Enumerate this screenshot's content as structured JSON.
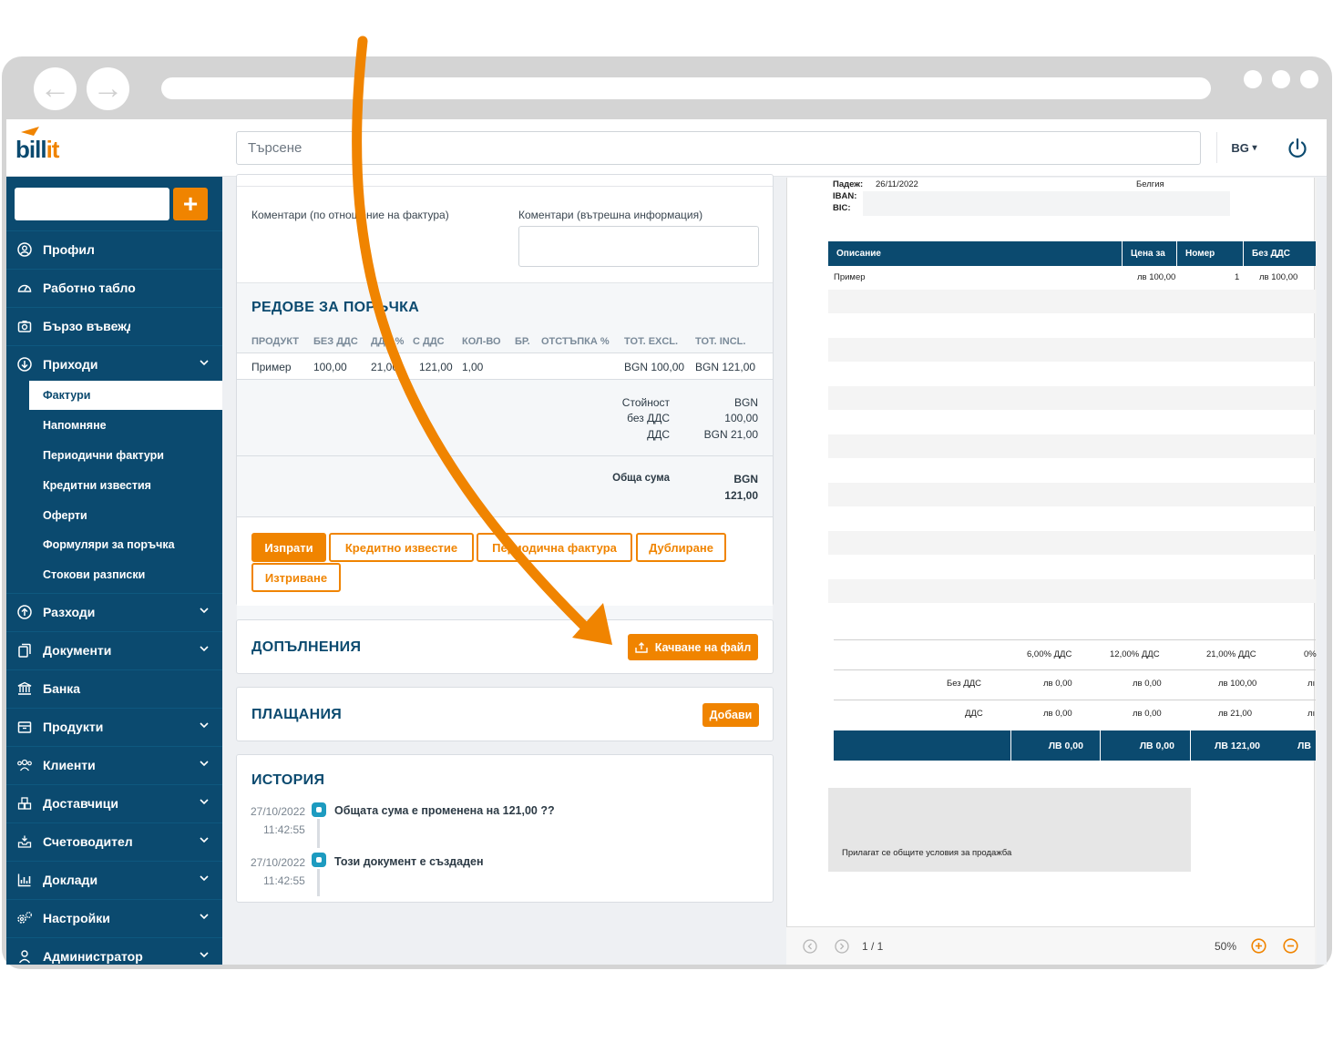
{
  "browser": {
    "back_glyph": "←",
    "forward_glyph": "→"
  },
  "topbar": {
    "logo_left": "bill",
    "logo_right": "it",
    "search_placeholder": "Търсене",
    "language": "BG",
    "language_caret": "▾"
  },
  "sidebar": {
    "plus": "+",
    "items": [
      {
        "label": "Профил",
        "icon": "user-circle-icon"
      },
      {
        "label": "Работно табло",
        "icon": "dashboard-icon"
      },
      {
        "label": "Бързо въвеждане",
        "icon": "camera-icon"
      },
      {
        "label": "Приходи",
        "icon": "income-arrow-icon"
      }
    ],
    "subitems": [
      "Фактури",
      "Напомняне",
      "Периодични фактури",
      "Кредитни известия",
      "Оферти",
      "Формуляри за поръчка",
      "Стокови разписки"
    ],
    "items2": [
      {
        "label": "Разходи",
        "icon": "expense-arrow-icon"
      },
      {
        "label": "Документи",
        "icon": "documents-icon"
      },
      {
        "label": "Банка",
        "icon": "bank-icon"
      },
      {
        "label": "Продукти",
        "icon": "box-icon"
      },
      {
        "label": "Клиенти",
        "icon": "users-icon"
      },
      {
        "label": "Доставчици",
        "icon": "boxes-icon"
      },
      {
        "label": "Счетоводител",
        "icon": "inbox-icon"
      },
      {
        "label": "Доклади",
        "icon": "chart-icon"
      },
      {
        "label": "Настройки",
        "icon": "gears-icon"
      },
      {
        "label": "Администратор",
        "icon": "admin-icon"
      }
    ]
  },
  "comments": {
    "external_label": "Коментари (по отношение на фактура)",
    "internal_label": "Коментари (вътрешна информация)"
  },
  "order_lines": {
    "title": "РЕДОВЕ ЗА ПОРЪЧКА",
    "headers": [
      "ПРОДУКТ",
      "БЕЗ ДДС",
      "ДДС %",
      "С ДДС",
      "КОЛ-ВО",
      "БР.",
      "ОТСТЪПКА %",
      "TOT. EXCL.",
      "TOT. INCL."
    ],
    "row": [
      "Пример",
      "100,00",
      "21,00",
      "121,00",
      "1,00",
      "",
      "",
      "BGN 100,00",
      "BGN 121,00"
    ],
    "totals": {
      "value_label": "Стойност",
      "value": "BGN",
      "excl_label": "без ДДС",
      "excl": "100,00",
      "vat_label": "ДДС",
      "vat": "BGN 21,00",
      "total_label": "Обща сума",
      "total_cur": "BGN",
      "total": "121,00"
    },
    "buttons": {
      "send": "Изпрати",
      "credit_note": "Кредитно известие",
      "recurring": "Периодична фактура",
      "duplicate": "Дублиране",
      "delete": "Изтриване"
    }
  },
  "attachments": {
    "title": "ДОПЪЛНЕНИЯ",
    "upload": "Качване на файл"
  },
  "payments": {
    "title": "ПЛАЩАНИЯ",
    "add": "Добави"
  },
  "history": {
    "title": "ИСТОРИЯ",
    "entries": [
      {
        "date": "27/10/2022",
        "time": "11:42:55",
        "text": "Общата сума е променена на 121,00 ??"
      },
      {
        "date": "27/10/2022",
        "time": "11:42:55",
        "text": "Този документ е създаден"
      }
    ]
  },
  "preview": {
    "due_label": "Падеж:",
    "due": "26/11/2022",
    "country": "Белгия",
    "iban_label": "IBAN:",
    "bic_label": "BIC:",
    "table_headers": [
      "Описание",
      "Цена за",
      "Номер",
      "Без ДДС"
    ],
    "line": {
      "desc": "Пример",
      "price": "лв 100,00",
      "qty": "1",
      "excl": "лв 100,00"
    },
    "vat_rates": [
      "6,00% ДДС",
      "12,00% ДДС",
      "21,00% ДДС",
      "0%"
    ],
    "excl_row": {
      "label": "Без ДДС",
      "values": [
        "лв 0,00",
        "лв 0,00",
        "лв 100,00",
        "лı"
      ]
    },
    "vat_row": {
      "label": "ДДС",
      "values": [
        "лв 0,00",
        "лв 0,00",
        "лв 21,00",
        "лı"
      ]
    },
    "total_row": [
      "ЛВ 0,00",
      "ЛВ 0,00",
      "ЛВ 121,00",
      "ЛВ"
    ],
    "terms": "Прилагат се общите условия за продажба",
    "pager": "1 / 1",
    "zoom": "50%"
  },
  "colors": {
    "brand": "#0b4a6f",
    "accent": "#f08400",
    "history_dot": "#1d9bc0"
  }
}
